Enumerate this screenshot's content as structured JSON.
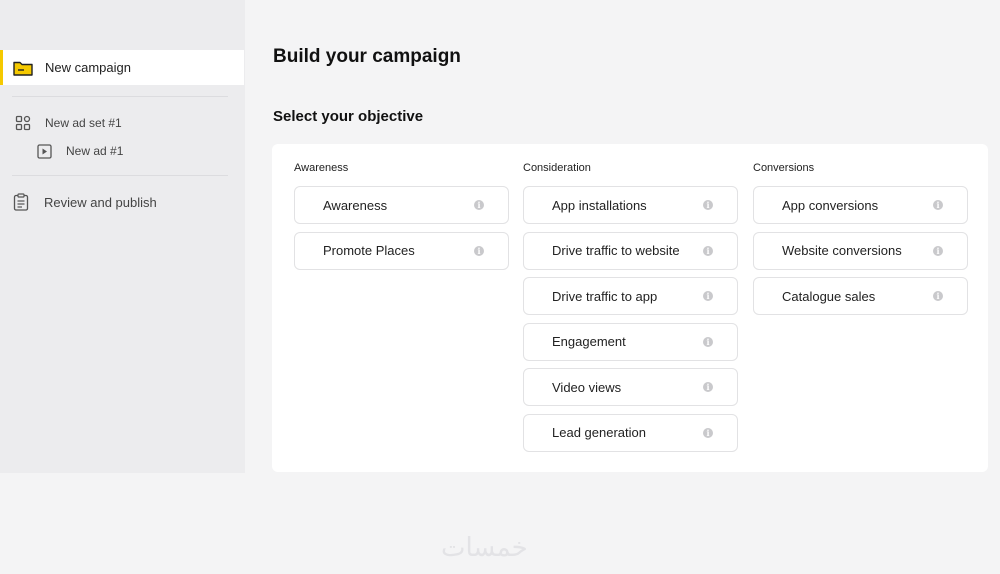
{
  "sidebar": {
    "items": [
      {
        "label": "New campaign",
        "icon": "folder-icon"
      },
      {
        "label": "New ad set #1",
        "icon": "grid-icon"
      },
      {
        "label": "New ad #1",
        "icon": "play-icon"
      },
      {
        "label": "Review and publish",
        "icon": "clipboard-icon"
      }
    ],
    "accent_color": "#f5c900"
  },
  "main": {
    "title": "Build your campaign",
    "subtitle": "Select your objective",
    "columns": [
      {
        "header": "Awareness",
        "options": [
          "Awareness",
          "Promote Places"
        ]
      },
      {
        "header": "Consideration",
        "options": [
          "App installations",
          "Drive traffic to website",
          "Drive traffic to app",
          "Engagement",
          "Video views",
          "Lead generation"
        ]
      },
      {
        "header": "Conversions",
        "options": [
          "App conversions",
          "Website conversions",
          "Catalogue sales"
        ]
      }
    ],
    "info_glyph": "i"
  },
  "watermark": "خمسات"
}
